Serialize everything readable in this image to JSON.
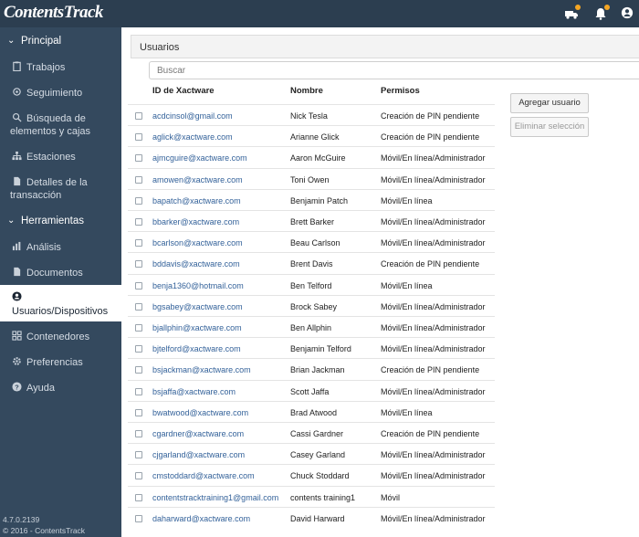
{
  "app": {
    "logo": "ContentsTrack",
    "truck_icon": "truck-icon",
    "bell_icon": "bell-icon",
    "user_icon": "user-icon",
    "notification_color": "#f5a623"
  },
  "sidebar": {
    "sections": [
      {
        "label": "Principal",
        "icon": "chevron-down-icon"
      },
      {
        "label": "Herramientas",
        "icon": "chevron-down-icon"
      }
    ],
    "items": [
      {
        "label": "Trabajos",
        "icon": "clipboard-icon"
      },
      {
        "label": "Seguimiento",
        "icon": "crosshair-icon"
      },
      {
        "label": "Búsqueda de elementos y cajas",
        "icon": "search-icon"
      },
      {
        "label": "Estaciones",
        "icon": "sitemap-icon"
      },
      {
        "label": "Detalles de la transacción",
        "icon": "file-icon"
      },
      {
        "label": "Análisis",
        "icon": "bar-chart-icon"
      },
      {
        "label": "Documentos",
        "icon": "document-icon"
      },
      {
        "label": "Usuarios/Dispositivos",
        "icon": "user-circle-icon"
      },
      {
        "label": "Contenedores",
        "icon": "grid-icon"
      },
      {
        "label": "Preferencias",
        "icon": "gear-icon"
      },
      {
        "label": "Ayuda",
        "icon": "help-icon"
      }
    ],
    "version": "4.7.0.2139",
    "copyright": "© 2016 - ContentsTrack"
  },
  "main": {
    "title": "Usuarios",
    "search_placeholder": "Buscar",
    "columns": [
      "ID de Xactware",
      "Nombre",
      "Permisos"
    ],
    "add_button": "Agregar usuario",
    "delete_button": "Eliminar selección",
    "rows": [
      {
        "id": "acdcinsol@gmail.com",
        "name": "Nick Tesla",
        "perm": "Creación de PIN pendiente"
      },
      {
        "id": "aglick@xactware.com",
        "name": "Arianne Glick",
        "perm": "Creación de PIN pendiente"
      },
      {
        "id": "ajmcguire@xactware.com",
        "name": "Aaron McGuire",
        "perm": "Móvil/En línea/Administrador"
      },
      {
        "id": "amowen@xactware.com",
        "name": "Toni Owen",
        "perm": "Móvil/En línea/Administrador"
      },
      {
        "id": "bapatch@xactware.com",
        "name": "Benjamin Patch",
        "perm": "Móvil/En línea"
      },
      {
        "id": "bbarker@xactware.com",
        "name": "Brett Barker",
        "perm": "Móvil/En línea/Administrador"
      },
      {
        "id": "bcarlson@xactware.com",
        "name": "Beau Carlson",
        "perm": "Móvil/En línea/Administrador"
      },
      {
        "id": "bddavis@xactware.com",
        "name": "Brent Davis",
        "perm": "Creación de PIN pendiente"
      },
      {
        "id": "benja1360@hotmail.com",
        "name": "Ben Telford",
        "perm": "Móvil/En línea"
      },
      {
        "id": "bgsabey@xactware.com",
        "name": "Brock Sabey",
        "perm": "Móvil/En línea/Administrador"
      },
      {
        "id": "bjallphin@xactware.com",
        "name": "Ben Allphin",
        "perm": "Móvil/En línea/Administrador"
      },
      {
        "id": "bjtelford@xactware.com",
        "name": "Benjamin Telford",
        "perm": "Móvil/En línea/Administrador"
      },
      {
        "id": "bsjackman@xactware.com",
        "name": "Brian Jackman",
        "perm": "Creación de PIN pendiente"
      },
      {
        "id": "bsjaffa@xactware.com",
        "name": "Scott Jaffa",
        "perm": "Móvil/En línea/Administrador"
      },
      {
        "id": "bwatwood@xactware.com",
        "name": "Brad Atwood",
        "perm": "Móvil/En línea"
      },
      {
        "id": "cgardner@xactware.com",
        "name": "Cassi Gardner",
        "perm": "Creación de PIN pendiente"
      },
      {
        "id": "cjgarland@xactware.com",
        "name": "Casey Garland",
        "perm": "Móvil/En línea/Administrador"
      },
      {
        "id": "cmstoddard@xactware.com",
        "name": "Chuck Stoddard",
        "perm": "Móvil/En línea/Administrador"
      },
      {
        "id": "contentstracktraining1@gmail.com",
        "name": "contents training1",
        "perm": "Móvil"
      },
      {
        "id": "daharward@xactware.com",
        "name": "David Harward",
        "perm": "Móvil/En línea/Administrador"
      }
    ]
  }
}
